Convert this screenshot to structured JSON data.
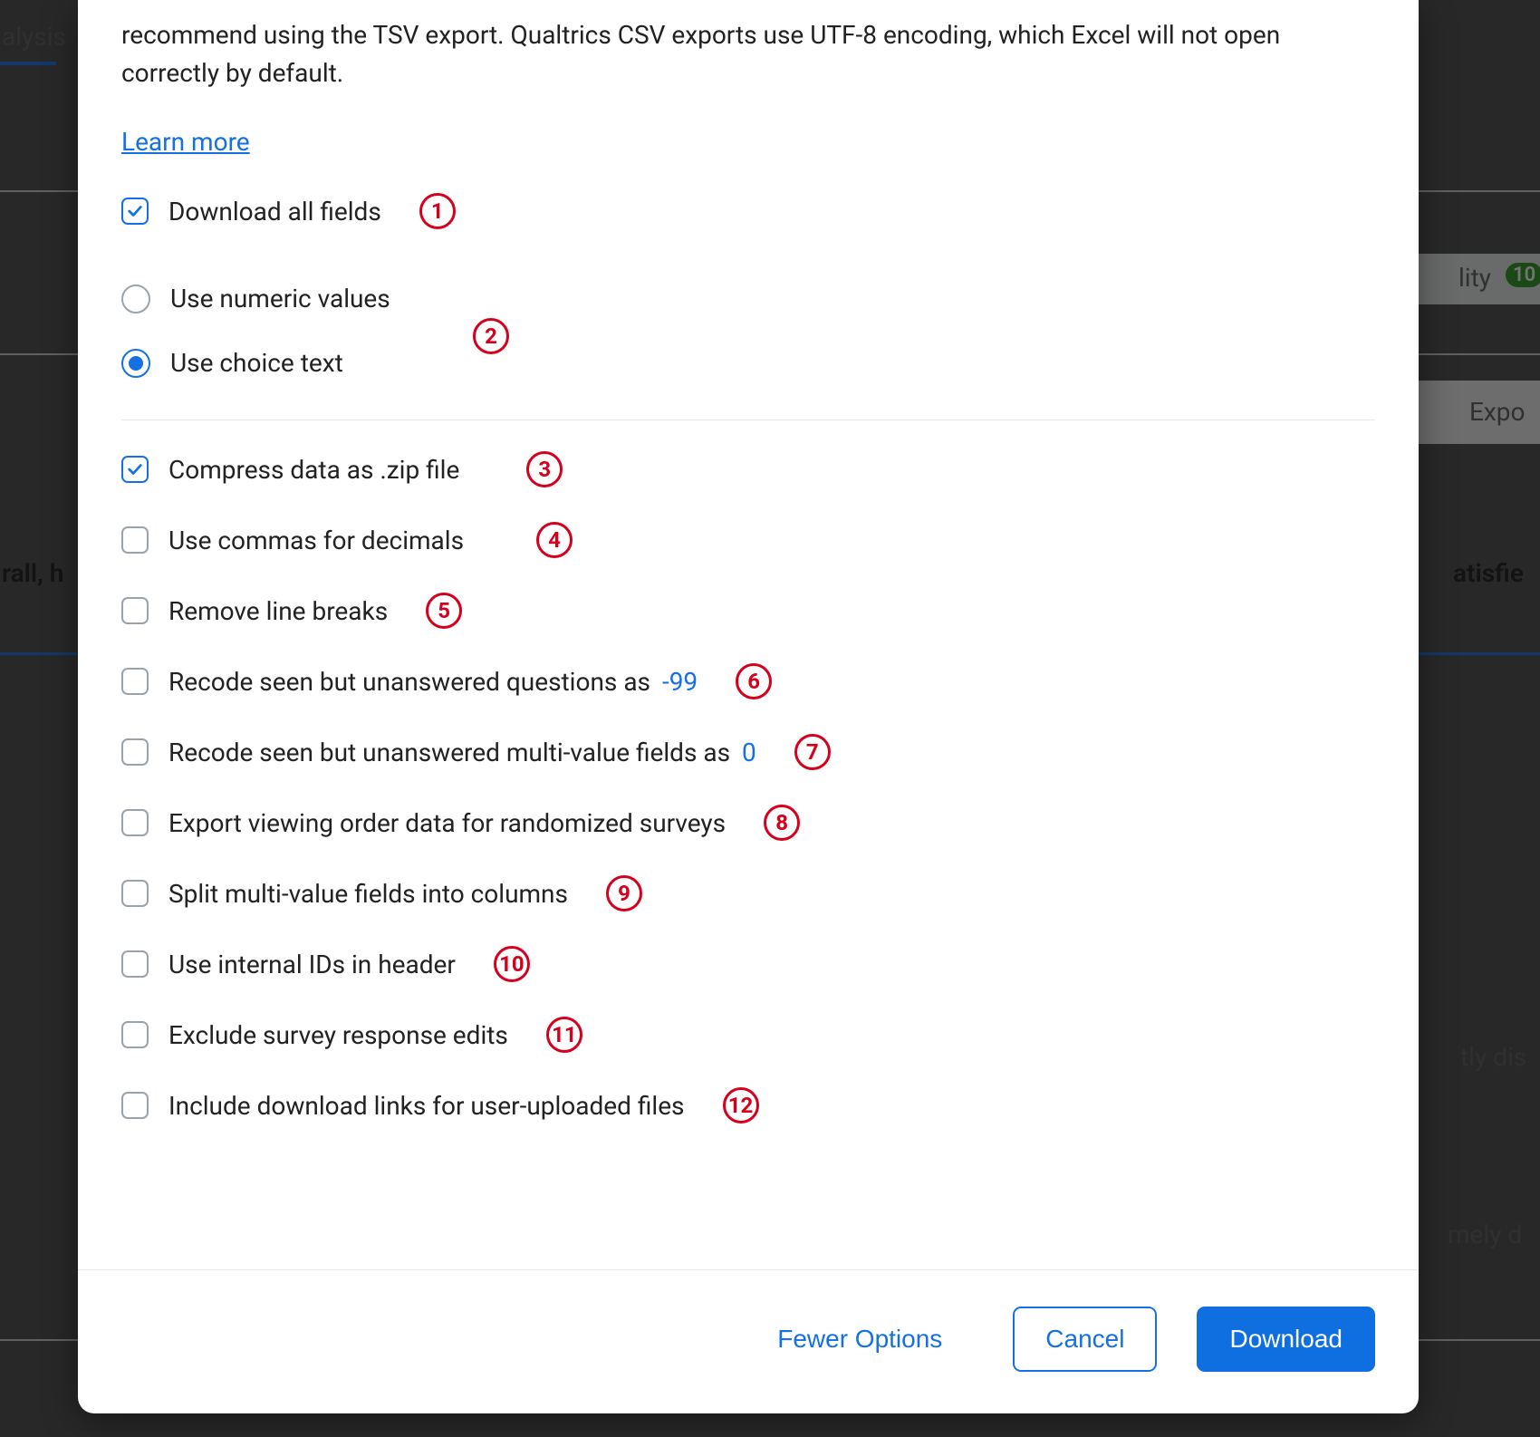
{
  "background": {
    "tab_fragment_left": "alysis",
    "label_fragment_left": "rall, h",
    "right_top_fragment": "lity",
    "right_top_badge": "10",
    "right_export_fragment": "Expo",
    "right_satisfied_fragment": "atisfie",
    "right_dis_fragment": "tly dis",
    "right_mely_fragment": "mely d"
  },
  "modal": {
    "description": "recommend using the TSV export. Qualtrics CSV exports use UTF-8 encoding, which Excel will not open correctly by default.",
    "learn_more": "Learn more",
    "download_all_fields": "Download all fields",
    "use_numeric_values": "Use numeric values",
    "use_choice_text": "Use choice text",
    "compress_zip": "Compress data as .zip file",
    "commas_decimals": "Use commas for decimals",
    "remove_line_breaks": "Remove line breaks",
    "recode_unanswered_prefix": "Recode seen but unanswered questions as",
    "recode_unanswered_value": "-99",
    "recode_multi_prefix": "Recode seen but unanswered multi-value fields as",
    "recode_multi_value": "0",
    "export_viewing_order": "Export viewing order data for randomized surveys",
    "split_multi": "Split multi-value fields into columns",
    "internal_ids": "Use internal IDs in header",
    "exclude_edits": "Exclude survey response edits",
    "include_download_links": "Include download links for user-uploaded files",
    "markers": {
      "m1": "1",
      "m2": "2",
      "m3": "3",
      "m4": "4",
      "m5": "5",
      "m6": "6",
      "m7": "7",
      "m8": "8",
      "m9": "9",
      "m10": "10",
      "m11": "11",
      "m12": "12"
    },
    "footer": {
      "fewer_options": "Fewer Options",
      "cancel": "Cancel",
      "download": "Download"
    }
  }
}
